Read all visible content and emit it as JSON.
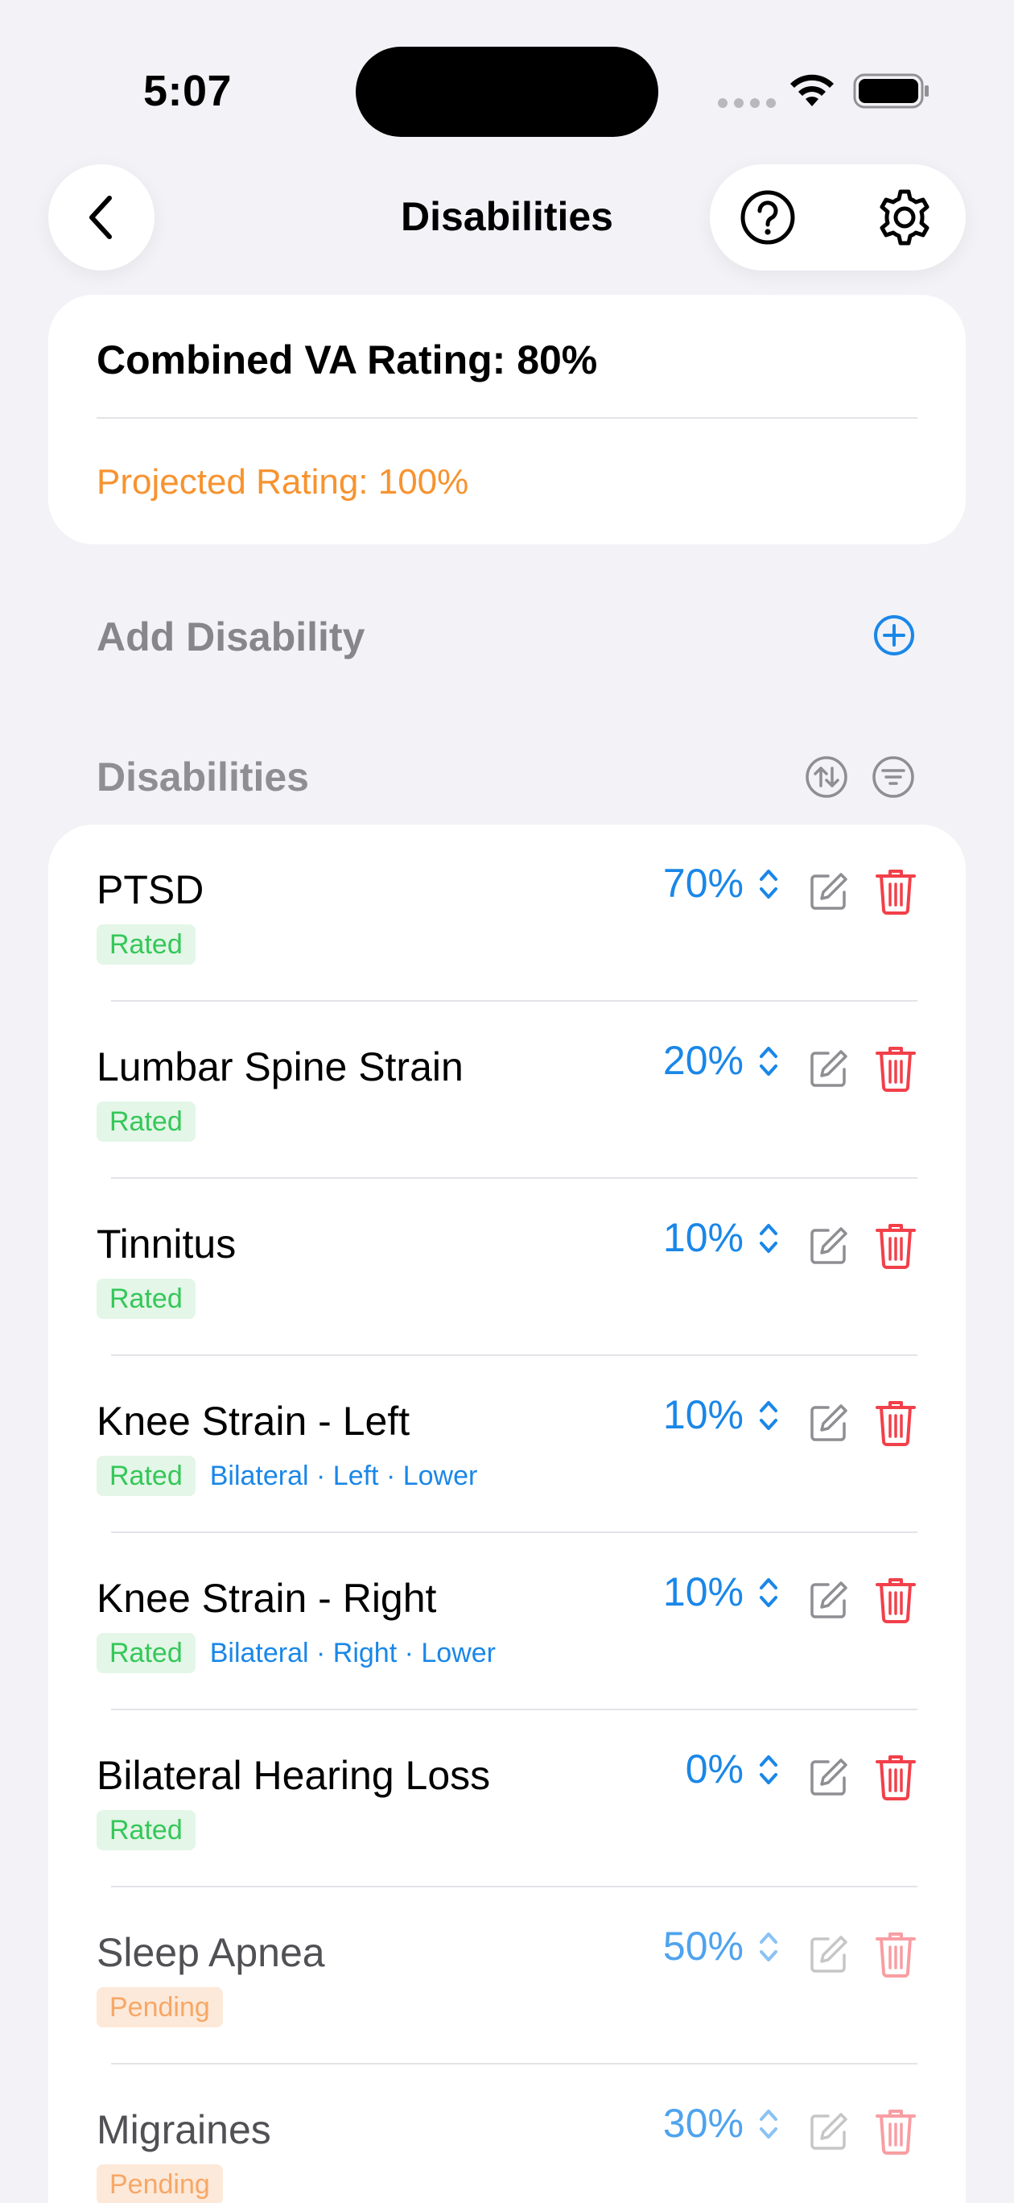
{
  "status_bar": {
    "time": "5:07"
  },
  "nav": {
    "title": "Disabilities"
  },
  "summary": {
    "combined": "Combined VA Rating: 80%",
    "projected": "Projected Rating: 100%"
  },
  "add": {
    "label": "Add Disability"
  },
  "section": {
    "label": "Disabilities"
  },
  "colors": {
    "accent": "#1a87e8",
    "projected": "#f7932f",
    "rated": "#35c759",
    "pending": "#f7a766",
    "delete": "#f2404a"
  },
  "disabilities": [
    {
      "name": "PTSD",
      "status": "Rated",
      "percent": "70%",
      "detail": ""
    },
    {
      "name": "Lumbar Spine Strain",
      "status": "Rated",
      "percent": "20%",
      "detail": ""
    },
    {
      "name": "Tinnitus",
      "status": "Rated",
      "percent": "10%",
      "detail": ""
    },
    {
      "name": "Knee Strain - Left",
      "status": "Rated",
      "percent": "10%",
      "detail": "Bilateral · Left · Lower"
    },
    {
      "name": "Knee Strain - Right",
      "status": "Rated",
      "percent": "10%",
      "detail": "Bilateral · Right · Lower"
    },
    {
      "name": "Bilateral Hearing Loss",
      "status": "Rated",
      "percent": "0%",
      "detail": ""
    },
    {
      "name": "Sleep Apnea",
      "status": "Pending",
      "percent": "50%",
      "detail": ""
    },
    {
      "name": "Migraines",
      "status": "Pending",
      "percent": "30%",
      "detail": ""
    }
  ]
}
